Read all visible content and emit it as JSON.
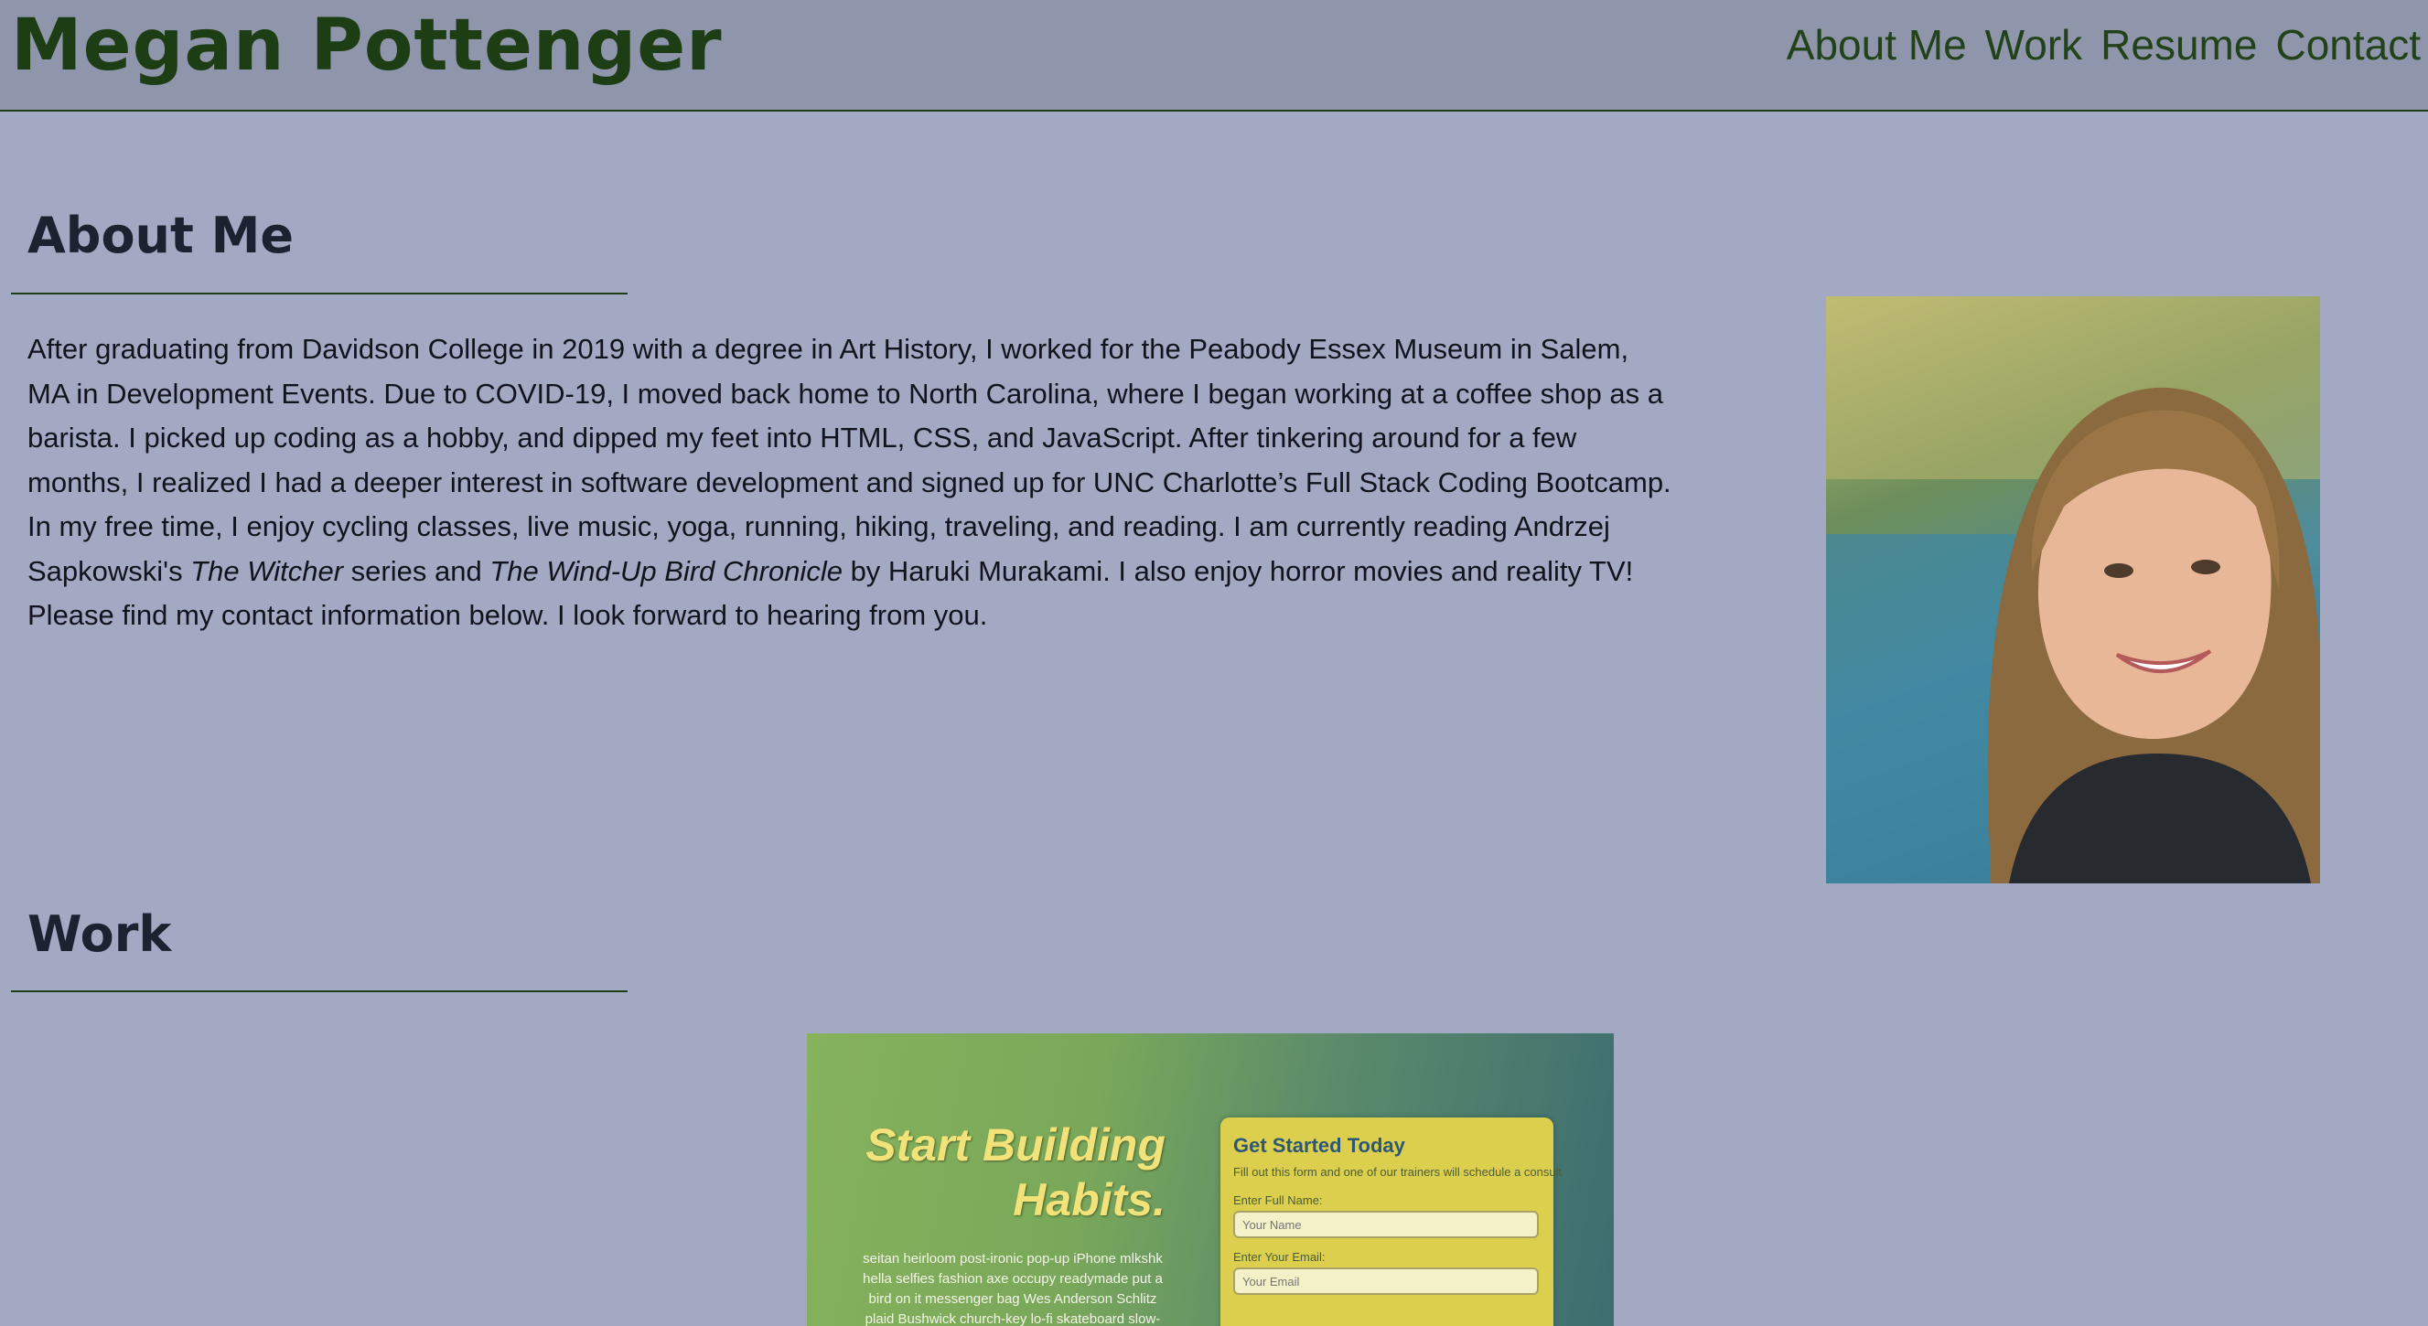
{
  "header": {
    "site_title": "Megan Pottenger",
    "nav": [
      "About Me",
      "Work",
      "Resume",
      "Contact"
    ]
  },
  "about": {
    "heading": "About Me",
    "paragraph_before": "After graduating from Davidson College in 2019 with a degree in Art History, I worked for the Peabody Essex Museum in Salem, MA in Development Events. Due to COVID-19, I moved back home to North Carolina, where I began working at a coffee shop as a barista. I picked up coding as a hobby, and dipped my feet into HTML, CSS, and JavaScript. After tinkering around for a few months, I realized I had a deeper interest in software development and signed up for UNC Charlotte’s Full Stack Coding Bootcamp. In my free time, I enjoy cycling classes, live music, yoga, running, hiking, traveling, and reading. I am currently reading Andrzej Sapkowski's ",
    "book_one": "The Witcher",
    "between_books": " series and ",
    "book_two": "The Wind-Up Bird Chronicle",
    "paragraph_after": " by Haruki Murakami. I also enjoy horror movies and reality TV! Please find my contact information below. I look forward to hearing from you."
  },
  "work": {
    "heading": "Work",
    "project_screenshot": {
      "headline_line1": "Start Building",
      "headline_line2": "Habits.",
      "blurb": "seitan heirloom post-ironic pop-up iPhone mlkshk hella selfies fashion axe occupy readymade put a bird on it messenger bag Wes Anderson Schlitz plaid Bushwick church-key lo-fi skateboard slow-carb hashtag trust fund",
      "form_title": "Get Started Today",
      "form_subtitle": "Fill out this form and one of our trainers will schedule a consult",
      "name_label": "Enter Full Name:",
      "name_placeholder": "Your Name",
      "email_label": "Enter Your Email:",
      "email_placeholder": "Your Email"
    }
  },
  "colors": {
    "page_background": "#a3a8c3",
    "header_background": "#8f95aa",
    "accent_green": "#1d3d14",
    "heading_text": "#1b2230"
  }
}
